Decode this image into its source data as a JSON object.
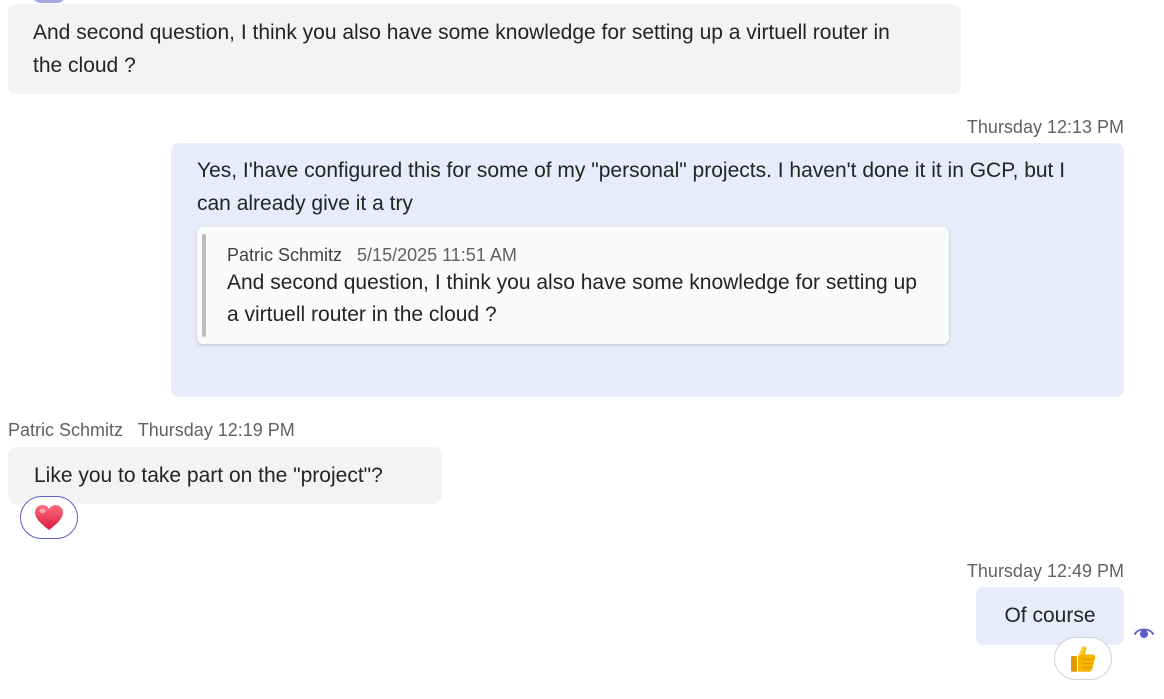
{
  "messages": [
    {
      "text": "And second question, I think you also have some knowledge for setting up a virtuell router in the cloud ?"
    },
    {
      "timestamp": "Thursday 12:13 PM",
      "text": "Yes, I'have configured this for some of my \"personal\" projects. I haven't done it it in GCP, but I can already give it a try",
      "quote": {
        "sender": "Patric Schmitz",
        "timestamp": "5/15/2025 11:51 AM",
        "text": "And second question, I think you also have some knowledge for setting up a virtuell router in the cloud ?"
      }
    },
    {
      "sender": "Patric Schmitz",
      "timestamp": "Thursday 12:19 PM",
      "text": "Like you to take part on the \"project\"?",
      "reaction": "heart-icon"
    },
    {
      "timestamp": "Thursday 12:49 PM",
      "text": "Of course",
      "reaction": "thumbs-up-icon",
      "status": "seen-icon"
    }
  ],
  "colors": {
    "incoming_bubble": "#f3f3f3",
    "outgoing_bubble": "#e8ebfa",
    "accent": "#5b5fc7",
    "heart": "#e8384f",
    "thumbs_up": "#f7b500"
  }
}
